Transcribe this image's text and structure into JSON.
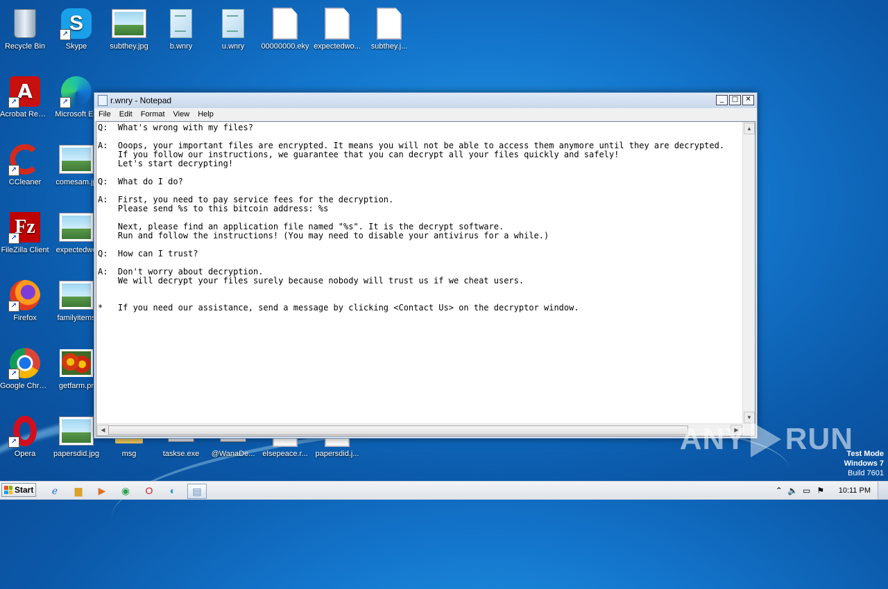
{
  "desktop_icons": [
    {
      "label": "Recycle Bin",
      "type": "recycle",
      "shortcut": false
    },
    {
      "label": "Skype",
      "type": "skype",
      "shortcut": true
    },
    {
      "label": "subthey.jpg",
      "type": "photo",
      "shortcut": false
    },
    {
      "label": "b.wnry",
      "type": "doc",
      "shortcut": false
    },
    {
      "label": "u.wnry",
      "type": "doc",
      "shortcut": false
    },
    {
      "label": "00000000.eky",
      "type": "blank",
      "shortcut": false
    },
    {
      "label": "expectedwo...",
      "type": "blank",
      "shortcut": false
    },
    {
      "label": "subthey.j...",
      "type": "blank",
      "shortcut": false
    },
    {
      "label": "Acrobat Reader DC",
      "type": "acrobat",
      "shortcut": true
    },
    {
      "label": "Microsoft Ed",
      "type": "edge",
      "shortcut": true
    },
    {
      "label": "CCleaner",
      "type": "ccleaner",
      "shortcut": true
    },
    {
      "label": "comesam.jp",
      "type": "photo",
      "shortcut": false
    },
    {
      "label": "FileZilla Client",
      "type": "filezilla",
      "shortcut": true
    },
    {
      "label": "expectedwo",
      "type": "photo",
      "shortcut": false
    },
    {
      "label": "Firefox",
      "type": "firefox",
      "shortcut": true
    },
    {
      "label": "familyitems",
      "type": "photo",
      "shortcut": false
    },
    {
      "label": "Google Chrome",
      "type": "chrome",
      "shortcut": true
    },
    {
      "label": "getfarm.pr",
      "type": "flowers",
      "shortcut": false
    },
    {
      "label": "Opera",
      "type": "opera",
      "shortcut": true
    },
    {
      "label": "papersdid.jpg",
      "type": "photo",
      "shortcut": false
    },
    {
      "label": "msg",
      "type": "folder",
      "shortcut": false
    },
    {
      "label": "taskse.exe",
      "type": "exe",
      "shortcut": false
    },
    {
      "label": "@WanaDe...",
      "type": "exe",
      "shortcut": false
    },
    {
      "label": "elsepeace.r...",
      "type": "blank",
      "shortcut": false
    },
    {
      "label": "papersdid.j...",
      "type": "blank",
      "shortcut": false
    }
  ],
  "notepad": {
    "title": "r.wnry - Notepad",
    "menu": [
      "File",
      "Edit",
      "Format",
      "View",
      "Help"
    ],
    "content": "Q:  What's wrong with my files?\n\nA:  Ooops, your important files are encrypted. It means you will not be able to access them anymore until they are decrypted.\n    If you follow our instructions, we guarantee that you can decrypt all your files quickly and safely!\n    Let's start decrypting!\n\nQ:  What do I do?\n\nA:  First, you need to pay service fees for the decryption.\n    Please send %s to this bitcoin address: %s\n\n    Next, please find an application file named \"%s\". It is the decrypt software.\n    Run and follow the instructions! (You may need to disable your antivirus for a while.)\n\nQ:  How can I trust?\n\nA:  Don't worry about decryption.\n    We will decrypt your files surely because nobody will trust us if we cheat users.\n\n\n*   If you need our assistance, send a message by clicking <Contact Us> on the decryptor window."
  },
  "taskbar": {
    "start_label": "Start",
    "clock": "10:11 PM"
  },
  "watermark": {
    "text_left": "ANY",
    "text_right": "RUN"
  },
  "test_mode": {
    "line1": "Test Mode",
    "line2": "Windows 7",
    "line3": "Build 7601"
  }
}
